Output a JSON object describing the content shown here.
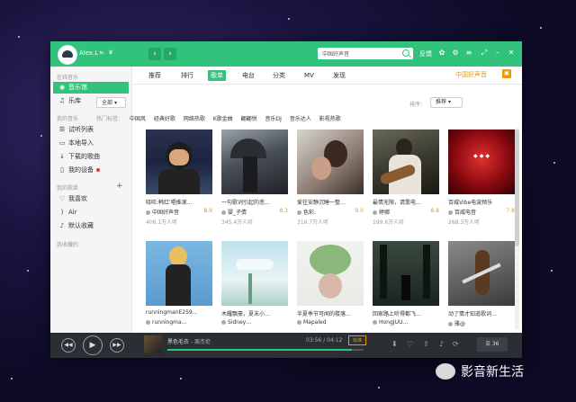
{
  "titlebar": {
    "username": "Alex.L",
    "user_icons": "℡ ♛",
    "search_value": "中国好声音",
    "feedback_label": "反馈"
  },
  "sidebar": {
    "section_online": "在线音乐",
    "section_my": "我的音乐",
    "section_playlists": "我的歌单",
    "section_collect": "我收藏的",
    "items_online": [
      {
        "label": "音乐馆",
        "icon": "music-hall-icon",
        "active": true
      },
      {
        "label": "乐库",
        "icon": "headphones-icon",
        "active": false
      }
    ],
    "items_my": [
      {
        "label": "试听列表",
        "icon": "list-icon"
      },
      {
        "label": "本地导入",
        "icon": "monitor-icon"
      },
      {
        "label": "下载的歌曲",
        "icon": "download-icon"
      },
      {
        "label": "我的设备",
        "icon": "device-icon"
      }
    ],
    "items_playlists": [
      {
        "label": "我喜欢",
        "icon": "heart-icon"
      },
      {
        "label": "Air",
        "icon": "sound-icon"
      },
      {
        "label": "默认收藏",
        "icon": "collect-icon"
      }
    ]
  },
  "tabs": {
    "items": [
      "推荐",
      "排行",
      "歌单",
      "电台",
      "分类",
      "MV",
      "发现"
    ],
    "active_index": 2,
    "right_label": "中国好声音"
  },
  "filter": {
    "all_label": "全部",
    "sort_label": "排序：",
    "sort_value": "推荐",
    "hot_label": "热门标签：",
    "hot_tags": [
      "中国风",
      "经典好歌",
      "网络热歌",
      "K歌金曲",
      "翩翩悦",
      "音乐DJ",
      "音乐达人",
      "影视热歌"
    ]
  },
  "cards": [
    {
      "title": "晓旺:韩红'唱推滚…",
      "author": "中国好声音",
      "score": "8.9",
      "listens": "406.1万人听",
      "theme": "voice-stage"
    },
    {
      "title": "一句歌词引起的悲…",
      "author": "婴_子倩",
      "score": "8.3",
      "listens": "345.4万人听",
      "theme": "rain"
    },
    {
      "title": "爱往安静沉睡一整…",
      "author": "色彩.",
      "score": "9.0",
      "listens": "316.7万人听",
      "theme": "couple"
    },
    {
      "title": "最情无限，请熏电…",
      "author": "婷娜",
      "score": "8.8",
      "listens": "199.6万人听",
      "theme": "guitar"
    },
    {
      "title": "百威Vibe电波频乐",
      "author": "百威电音",
      "score": "7.8",
      "listens": "268.3万人听",
      "theme": "vibe"
    },
    {
      "title": "runningmanE259…",
      "author": "runningma…",
      "score": "",
      "listens": "",
      "theme": "blonde"
    },
    {
      "title": "木耀飘豪，夏末小…",
      "author": "Sidney…",
      "score": "",
      "listens": "",
      "theme": "summer"
    },
    {
      "title": "半夏季节可闻的楼落…",
      "author": "Mapaled",
      "score": "",
      "listens": "",
      "theme": "flower"
    },
    {
      "title": "回家路上听得都飞…",
      "author": "HongJUU…",
      "score": "",
      "listens": "",
      "theme": "forest"
    },
    {
      "title": "动了情才知道歌词…",
      "author": "雅@",
      "score": "",
      "listens": "",
      "theme": "violin"
    }
  ],
  "player": {
    "song_title": "黑色毛衣",
    "song_artist": "周杰伦",
    "elapsed": "03:56",
    "total": "04:12",
    "progress": 0.94,
    "quality": "标准",
    "playlist_count": "36"
  },
  "watermark": {
    "text": "影音新生活"
  },
  "colors": {
    "accent": "#31c27c",
    "orange": "#f39800",
    "player_bg": "#2b2e33"
  }
}
